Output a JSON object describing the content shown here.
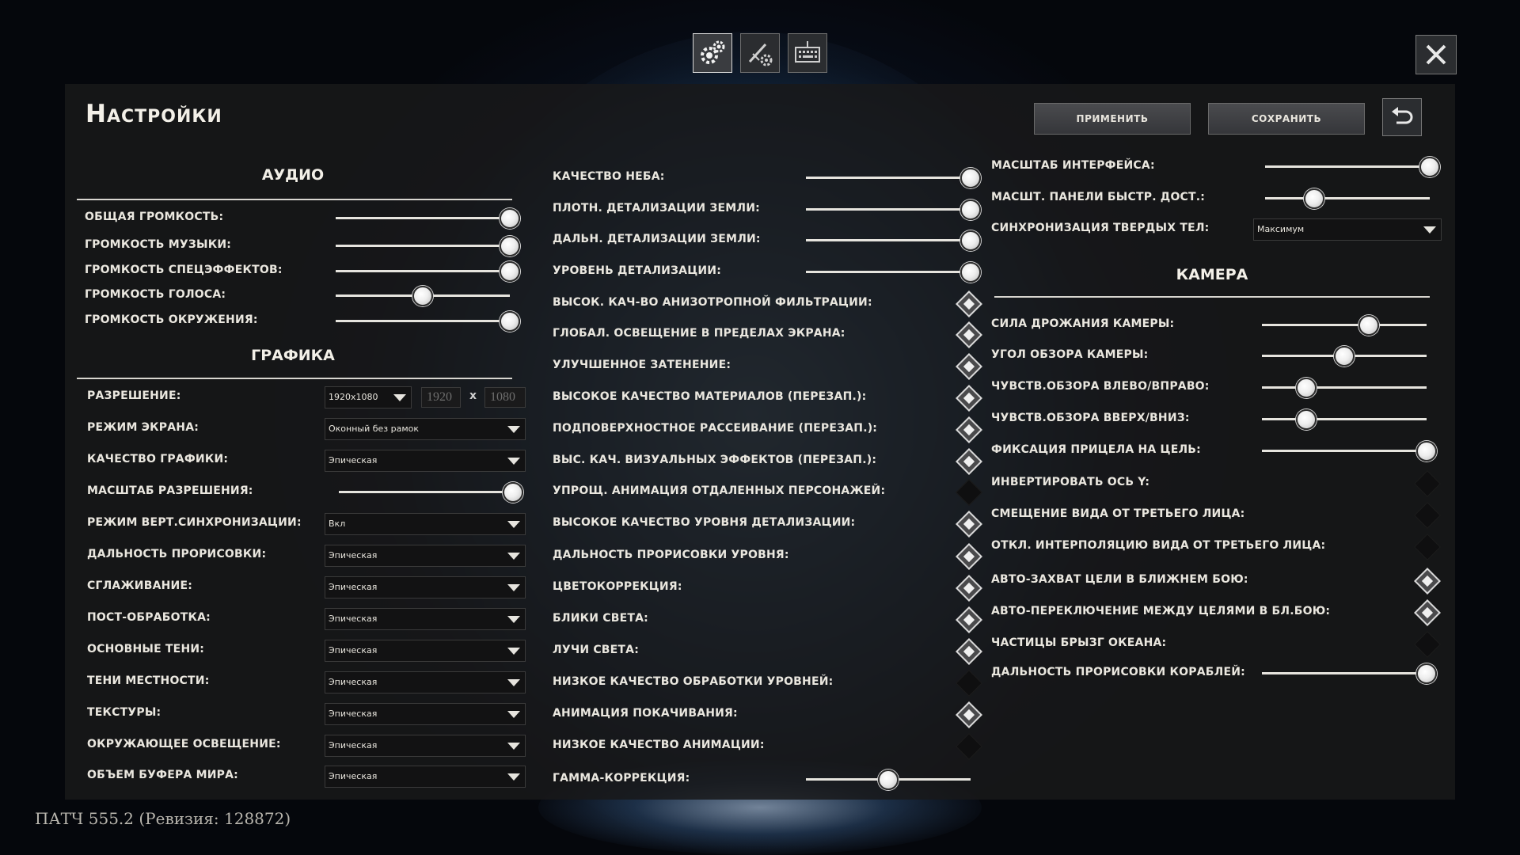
{
  "tabs": [
    {
      "name": "graphics-settings-tab",
      "icon": "gears-icon",
      "active": true
    },
    {
      "name": "gameplay-settings-tab",
      "icon": "sword-gear-icon",
      "active": false
    },
    {
      "name": "controls-settings-tab",
      "icon": "keyboard-icon",
      "active": false
    }
  ],
  "header": {
    "title": "Настройки",
    "apply_label": "Применить",
    "save_label": "Сохранить"
  },
  "audio": {
    "title": "Аудио",
    "items": [
      {
        "label": "Общая громкость:",
        "value": 1.0
      },
      {
        "label": "Громкость музыки:",
        "value": 1.0
      },
      {
        "label": "Громкость спецэффектов:",
        "value": 1.0
      },
      {
        "label": "Громкость голоса:",
        "value": 0.5
      },
      {
        "label": "Громкость окружения:",
        "value": 1.0
      }
    ]
  },
  "graphics": {
    "title": "Графика",
    "resolution": {
      "label": "Разрешение:",
      "value": "1920x1080",
      "width": "1920",
      "x": "x",
      "height": "1080"
    },
    "items": [
      {
        "label": "Режим экрана:",
        "type": "dropdown",
        "value": "Оконный без рамок"
      },
      {
        "label": "Качество графики:",
        "type": "dropdown",
        "value": "Эпическая"
      },
      {
        "label": "Масштаб разрешения:",
        "type": "slider",
        "value": 1.0
      },
      {
        "label": "Режим верт.синхронизации:",
        "type": "dropdown",
        "value": "Вкл"
      },
      {
        "label": "Дальность прорисовки:",
        "type": "dropdown",
        "value": "Эпическая"
      },
      {
        "label": "Сглаживание:",
        "type": "dropdown",
        "value": "Эпическая"
      },
      {
        "label": "Пост-обработка:",
        "type": "dropdown",
        "value": "Эпическая"
      },
      {
        "label": "Основные тени:",
        "type": "dropdown",
        "value": "Эпическая"
      },
      {
        "label": "Тени местности:",
        "type": "dropdown",
        "value": "Эпическая"
      },
      {
        "label": "Текстуры:",
        "type": "dropdown",
        "value": "Эпическая"
      },
      {
        "label": "Окружающее освещение:",
        "type": "dropdown",
        "value": "Эпическая"
      },
      {
        "label": "Объем буфера мира:",
        "type": "dropdown",
        "value": "Эпическая"
      }
    ]
  },
  "middle": {
    "items": [
      {
        "label": "Качество неба:",
        "type": "slider",
        "value": 1.0
      },
      {
        "label": "Плотн. детализации земли:",
        "type": "slider",
        "value": 1.0
      },
      {
        "label": "Дальн. детализации земли:",
        "type": "slider",
        "value": 1.0
      },
      {
        "label": "Уровень детализации:",
        "type": "slider",
        "value": 1.0
      },
      {
        "label": "Высок. кач-во анизотропной фильтрации:",
        "type": "checkbox",
        "checked": true
      },
      {
        "label": "Глобал. освещение в пределах экрана:",
        "type": "checkbox",
        "checked": true
      },
      {
        "label": "Улучшенное затенение:",
        "type": "checkbox",
        "checked": true
      },
      {
        "label": "Высокое качество материалов (перезап.):",
        "type": "checkbox",
        "checked": true
      },
      {
        "label": "Подповерхностное рассеивание (перезап.):",
        "type": "checkbox",
        "checked": true
      },
      {
        "label": "Выс. кач. визуальных эффектов (перезап.):",
        "type": "checkbox",
        "checked": true
      },
      {
        "label": "Упрощ. анимация отдаленных персонажей:",
        "type": "checkbox",
        "checked": false
      },
      {
        "label": "Высокое качество уровня детализации:",
        "type": "checkbox",
        "checked": true
      },
      {
        "label": "Дальность прорисовки уровня:",
        "type": "checkbox",
        "checked": true
      },
      {
        "label": "Цветокоррекция:",
        "type": "checkbox",
        "checked": true
      },
      {
        "label": "Блики света:",
        "type": "checkbox",
        "checked": true
      },
      {
        "label": "Лучи света:",
        "type": "checkbox",
        "checked": true
      },
      {
        "label": "Низкое качество обработки уровней:",
        "type": "checkbox",
        "checked": false
      },
      {
        "label": "Анимация покачивания:",
        "type": "checkbox",
        "checked": true
      },
      {
        "label": "Низкое качество анимации:",
        "type": "checkbox",
        "checked": false
      },
      {
        "label": "Гамма-коррекция:",
        "type": "slider",
        "value": 0.5
      }
    ]
  },
  "right_top": {
    "items": [
      {
        "label": "Масштаб интерфейса:",
        "type": "slider",
        "value": 1.0
      },
      {
        "label": "Масшт. панели быстр. дост.:",
        "type": "slider",
        "value": 0.3
      },
      {
        "label": "Синхронизация твердых тел:",
        "type": "dropdown",
        "value": "Максимум"
      }
    ]
  },
  "camera": {
    "title": "Камера",
    "items": [
      {
        "label": "Сила дрожания камеры:",
        "type": "slider",
        "value": 0.65
      },
      {
        "label": "Угол обзора камеры:",
        "type": "slider",
        "value": 0.5
      },
      {
        "label": "Чувств.обзора влево/вправо:",
        "type": "slider",
        "value": 0.27
      },
      {
        "label": "Чувств.обзора вверх/вниз:",
        "type": "slider",
        "value": 0.27
      },
      {
        "label": "Фиксация прицела на цель:",
        "type": "slider",
        "value": 1.0
      },
      {
        "label": "Инвертировать ось Y:",
        "type": "checkbox",
        "checked": false
      },
      {
        "label": "Смещение вида от третьего лица:",
        "type": "checkbox",
        "checked": false
      },
      {
        "label": "Откл. интерполяцию вида от третьего лица:",
        "type": "checkbox",
        "checked": false
      },
      {
        "label": "Авто-захват цели в ближнем бою:",
        "type": "checkbox",
        "checked": true
      },
      {
        "label": "Авто-переключение между целями в бл.бою:",
        "type": "checkbox",
        "checked": true
      },
      {
        "label": "Частицы брызг океана:",
        "type": "checkbox",
        "checked": false
      },
      {
        "label": "Дальность прорисовки кораблей:",
        "type": "slider",
        "value": 1.0
      }
    ]
  },
  "footer": {
    "patch": "ПАТЧ 555.2 (Ревизия: 128872)"
  },
  "colors": {
    "panel_bg": "#18181a",
    "accent_white": "#e6e4de",
    "button_bg": "#404145"
  }
}
